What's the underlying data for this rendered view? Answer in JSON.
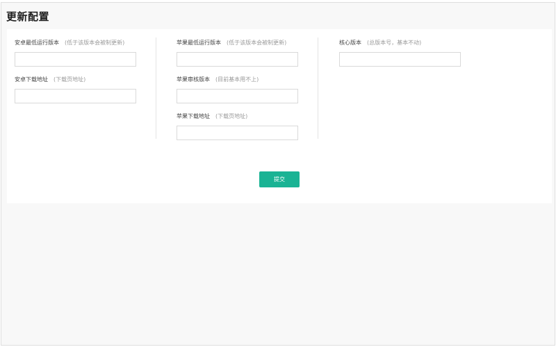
{
  "page": {
    "title": "更新配置"
  },
  "columns": [
    {
      "fields": [
        {
          "label": "安卓最低运行版本",
          "hint": "(低于该版本会被制更新)",
          "value": ""
        },
        {
          "label": "安卓下载地址",
          "hint": "(下载页地址)",
          "value": ""
        }
      ]
    },
    {
      "fields": [
        {
          "label": "苹果最低运行版本",
          "hint": "(低于该版本会被制更新)",
          "value": ""
        },
        {
          "label": "苹果审核版本",
          "hint": "(目前基本用不上)",
          "value": ""
        },
        {
          "label": "苹果下载地址",
          "hint": "(下载页地址)",
          "value": ""
        }
      ]
    },
    {
      "fields": [
        {
          "label": "核心版本",
          "hint": "(总版本号，基本不动)",
          "value": ""
        }
      ]
    }
  ],
  "actions": {
    "submit_label": "提交"
  },
  "colors": {
    "accent": "#1ab394",
    "panel": "#ffffff",
    "page_bg": "#f8f8f8"
  }
}
